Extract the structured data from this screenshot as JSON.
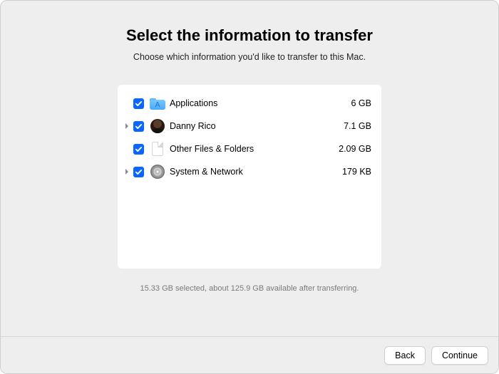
{
  "header": {
    "title": "Select the information to transfer",
    "subtitle": "Choose which information you'd like to transfer to this Mac."
  },
  "items": [
    {
      "label": "Applications",
      "size": "6 GB",
      "checked": true,
      "expandable": false,
      "icon": "folder-apps"
    },
    {
      "label": "Danny Rico",
      "size": "7.1 GB",
      "checked": true,
      "expandable": true,
      "icon": "avatar"
    },
    {
      "label": "Other Files & Folders",
      "size": "2.09 GB",
      "checked": true,
      "expandable": false,
      "icon": "document"
    },
    {
      "label": "System & Network",
      "size": "179 KB",
      "checked": true,
      "expandable": true,
      "icon": "gear"
    }
  ],
  "summary": "15.33 GB selected, about 125.9 GB available after transferring.",
  "footer": {
    "back": "Back",
    "continue": "Continue"
  }
}
